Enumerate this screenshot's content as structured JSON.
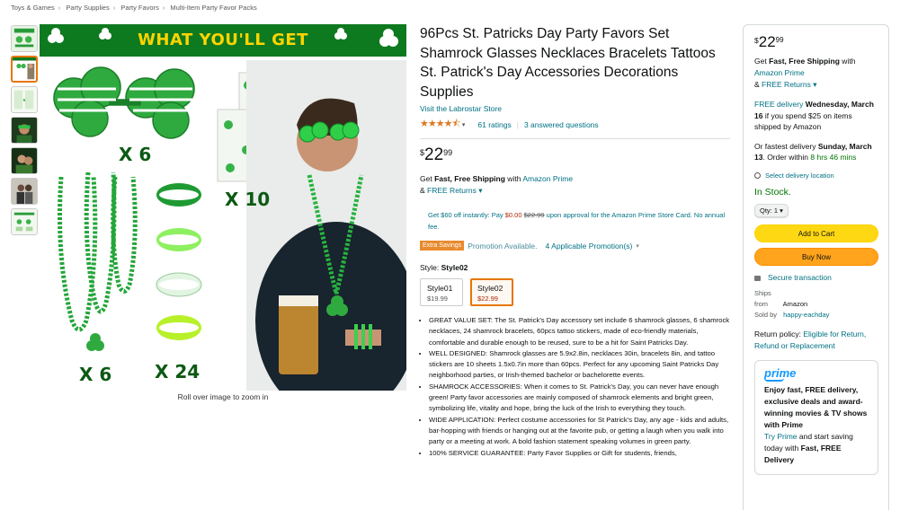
{
  "breadcrumb": [
    "Toys & Games",
    "Party Supplies",
    "Party Favors",
    "Multi-Item Party Favor Packs"
  ],
  "gallery": {
    "thumbnail_count": 7,
    "active_index": 1,
    "banner_text": "WHAT YOU'LL GET",
    "qty_labels": [
      "X 6",
      "X 10",
      "X 6",
      "X 24"
    ],
    "zoom_hint": "Roll over image to zoom in"
  },
  "product": {
    "title": "96Pcs St. Patricks Day Party Favors Set Shamrock Glasses Necklaces Bracelets Tattoos St. Patrick's Day Accessories Decorations Supplies",
    "store_link": "Visit the Labrostar Store",
    "rating_stars": "★★★★⯪",
    "rating_value": 4.5,
    "ratings_count": "61 ratings",
    "answered_questions": "3 answered questions",
    "price": {
      "symbol": "$",
      "whole": "22",
      "fraction": "99"
    },
    "shipping": {
      "prefix": "Get ",
      "bold": "Fast, Free Shipping",
      "mid": " with ",
      "link": "Amazon Prime"
    },
    "returns": {
      "prefix": "& ",
      "link": "FREE Returns"
    },
    "promo": {
      "text1": "Get $60 off instantly: Pay ",
      "pay_price": "$0.00",
      "strike_price": "$22.99",
      "text2": " upon approval for the Amazon Prime Store Card. No annual fee."
    },
    "savings": {
      "badge": "Extra Savings",
      "label": "Promotion Available.",
      "link": "4 Applicable Promotion(s)"
    },
    "style": {
      "label": "Style: ",
      "selected": "Style02",
      "options": [
        {
          "name": "Style01",
          "price": "$19.99",
          "selected": false
        },
        {
          "name": "Style02",
          "price": "$22.99",
          "selected": true
        }
      ]
    },
    "bullets": [
      "GREAT VALUE SET: The St. Patrick's Day accessory set include 6 shamrock glasses, 6 shamrock necklaces, 24 shamrock bracelets, 60pcs tattoo stickers, made of eco-friendly materials, comfortable and durable enough to be reused, sure to be a hit for Saint Patricks Day.",
      "WELL DESIGNED: Shamrock glasses are 5.9x2.8in, necklaces 30in, bracelets 8in, and tattoo stickers are 10 sheets 1.5x0.7in more than 60pcs. Perfect for any upcoming Saint Patricks Day neighborhood parties, or Irish-themed bachelor or bachelorette events.",
      "SHAMROCK ACCESSORIES: When it comes to St. Patrick's Day, you can never have enough green! Party favor accessories are mainly composed of shamrock elements and bright green, symbolizing life, vitality and hope, bring the luck of the Irish to everything they touch.",
      "WIDE APPLICATION: Perfect costume accessories for St Patrick's Day, any age - kids and adults, bar-hopping with friends or hanging out at the favorite pub, or getting a laugh when you walk into party or a meeting at work. A bold fashion statement speaking volumes in green party.",
      "100% SERVICE GUARANTEE: Party Favor Supplies or Gift for students, friends,"
    ]
  },
  "buybox": {
    "price": {
      "symbol": "$",
      "whole": "22",
      "fraction": "99"
    },
    "shipping": {
      "prefix": "Get ",
      "bold": "Fast, Free Shipping",
      "mid": " with ",
      "link": "Amazon Prime"
    },
    "returns": {
      "prefix": "& ",
      "link": "FREE Returns"
    },
    "delivery": {
      "link": "FREE delivery",
      "date": "Wednesday, March 16",
      "rest": " if you spend $25 on items shipped by Amazon"
    },
    "fastest": {
      "prefix": "Or fastest delivery ",
      "date": "Sunday, March 13",
      "mid": ". Order within ",
      "countdown": "8 hrs 46 mins"
    },
    "location_link": "Select delivery location",
    "stock": "In Stock.",
    "qty": "Qty: 1",
    "add_to_cart": "Add to Cart",
    "buy_now": "Buy Now",
    "secure": "Secure transaction",
    "ships_from_label": "Ships from",
    "ships_from": "Amazon",
    "sold_by_label": "Sold by",
    "sold_by": "happy-eachday",
    "return_policy_label": "Return policy: ",
    "return_policy_link": "Eligible for Return, Refund or Replacement",
    "prime": {
      "logo": "prime",
      "bold_text": "Enjoy fast, FREE delivery, exclusive deals and award-winning movies & TV shows with Prime",
      "link": "Try Prime",
      "mid": " and start saving today with ",
      "bold_end": "Fast, FREE Delivery"
    }
  },
  "colors": {
    "link": "#007185",
    "price_red": "#b12704",
    "in_stock_green": "#007600",
    "add_to_cart": "#ffd814",
    "buy_now": "#ffa41c",
    "selected_border": "#e77600",
    "banner_green": "#0e7a1f",
    "banner_text": "#ffd400",
    "prime_blue": "#1399ff"
  }
}
